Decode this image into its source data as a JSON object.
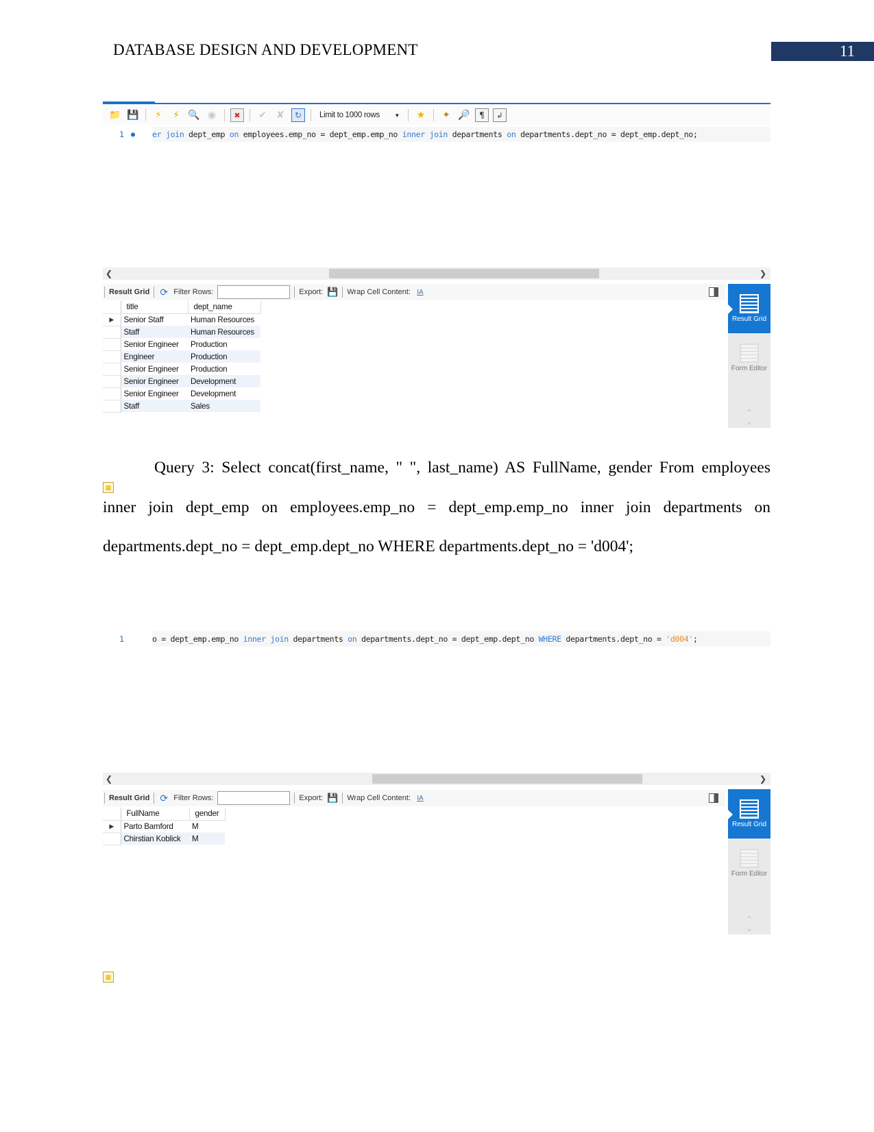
{
  "header": {
    "running_head": "DATABASE DESIGN AND DEVELOPMENT",
    "page_number": "11",
    "page_number_box_color": "#1f3864"
  },
  "screenshot1": {
    "toolbar": {
      "icons": [
        "folder-open-icon",
        "save-icon",
        "execute-icon",
        "execute-current-icon",
        "explain-icon",
        "stop-icon",
        "error-toggle-icon",
        "commit-icon",
        "rollback-icon",
        "autocommit-toggle-icon",
        "bookmark-icon",
        "beautify-icon",
        "find-icon",
        "invisible-chars-icon",
        "word-wrap-icon"
      ],
      "limit_rows": "Limit to 1000 rows"
    },
    "editor": {
      "line_number": "1",
      "code_parts": [
        {
          "t": "er join",
          "kw": true
        },
        {
          "t": " dept_emp ",
          "kw": false
        },
        {
          "t": "on",
          "kw": true
        },
        {
          "t": " employees.emp_no = dept_emp.emp_no ",
          "kw": false
        },
        {
          "t": "inner join",
          "kw": true
        },
        {
          "t": " departments ",
          "kw": false
        },
        {
          "t": "on",
          "kw": true
        },
        {
          "t": " departments.dept_no = dept_emp.dept_no;",
          "kw": false
        }
      ]
    },
    "result_bar": {
      "title": "Result Grid",
      "filter_label": "Filter Rows:",
      "filter_value": "",
      "export_label": "Export:",
      "wrap_label": "Wrap Cell Content:"
    },
    "grid": {
      "columns": [
        "title",
        "dept_name"
      ],
      "rows": [
        [
          "Senior Staff",
          "Human Resources"
        ],
        [
          "Staff",
          "Human Resources"
        ],
        [
          "Senior Engineer",
          "Production"
        ],
        [
          "Engineer",
          "Production"
        ],
        [
          "Senior Engineer",
          "Production"
        ],
        [
          "Senior Engineer",
          "Development"
        ],
        [
          "Senior Engineer",
          "Development"
        ],
        [
          "Staff",
          "Sales"
        ]
      ]
    },
    "side_panel": {
      "result_grid_label": "Result Grid",
      "form_editor_label": "Form Editor"
    }
  },
  "paragraph": {
    "text": "Query 3: Select concat(first_name, \" \", last_name) AS FullName, gender From employees inner join dept_emp on employees.emp_no = dept_emp.emp_no inner join departments on departments.dept_no = dept_emp.dept_no WHERE departments.dept_no = 'd004';"
  },
  "screenshot2": {
    "editor": {
      "line_number": "1",
      "code_parts": [
        {
          "t": "o = dept_emp.emp_no ",
          "kw": false
        },
        {
          "t": "inner join",
          "kw": true
        },
        {
          "t": " departments ",
          "kw": false
        },
        {
          "t": "on",
          "kw": true
        },
        {
          "t": " departments.dept_no = dept_emp.dept_no ",
          "kw": false
        },
        {
          "t": "WHERE",
          "kw": true
        },
        {
          "t": " departments.dept_no = ",
          "kw": false
        },
        {
          "t": "'d004'",
          "str": true
        },
        {
          "t": ";",
          "kw": false
        }
      ]
    },
    "result_bar": {
      "title": "Result Grid",
      "filter_label": "Filter Rows:",
      "filter_value": "",
      "export_label": "Export:",
      "wrap_label": "Wrap Cell Content:"
    },
    "grid": {
      "columns": [
        "FullName",
        "gender"
      ],
      "rows": [
        [
          "Parto Bamford",
          "M"
        ],
        [
          "Chirstian Koblick",
          "M"
        ]
      ]
    },
    "side_panel": {
      "result_grid_label": "Result Grid",
      "form_editor_label": "Form Editor"
    }
  },
  "colors": {
    "keyword": "#2e7cd1",
    "string": "#e08a2c",
    "accent": "#1677d2"
  }
}
